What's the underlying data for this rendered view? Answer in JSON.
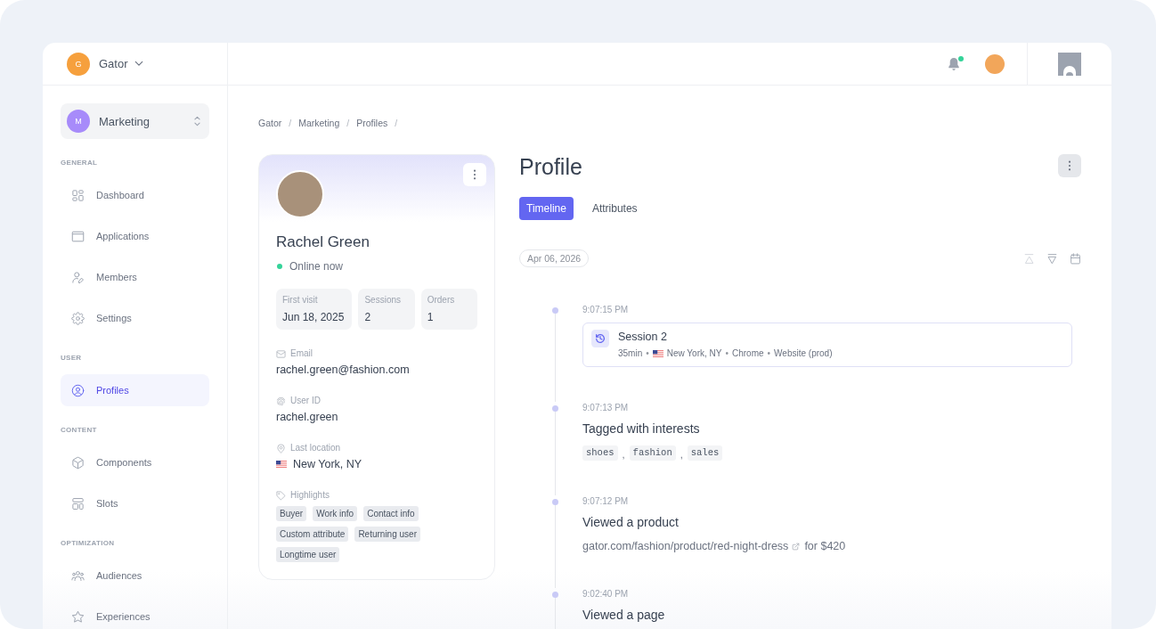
{
  "org": {
    "initial": "G",
    "name": "Gator"
  },
  "workspace": {
    "initial": "M",
    "name": "Marketing"
  },
  "sidebar": {
    "sections": [
      {
        "label": "GENERAL",
        "items": [
          {
            "label": "Dashboard",
            "selected": false
          },
          {
            "label": "Applications",
            "selected": false
          },
          {
            "label": "Members",
            "selected": false
          },
          {
            "label": "Settings",
            "selected": false
          }
        ]
      },
      {
        "label": "USER",
        "items": [
          {
            "label": "Profiles",
            "selected": true
          }
        ]
      },
      {
        "label": "CONTENT",
        "items": [
          {
            "label": "Components",
            "selected": false
          },
          {
            "label": "Slots",
            "selected": false
          }
        ]
      },
      {
        "label": "OPTIMIZATION",
        "items": [
          {
            "label": "Audiences",
            "selected": false
          },
          {
            "label": "Experiences",
            "selected": false
          }
        ]
      }
    ]
  },
  "top_bar": {
    "notifications": {
      "unread": true
    }
  },
  "breadcrumb": {
    "separator": "/",
    "items": [
      "Gator",
      "Marketing",
      "Profiles"
    ]
  },
  "profile_card": {
    "name": "Rachel Green",
    "status": {
      "label": "Online now",
      "online": true
    },
    "stats": [
      {
        "label": "First visit",
        "value": "Jun 18, 2025"
      },
      {
        "label": "Sessions",
        "value": "2"
      },
      {
        "label": "Orders",
        "value": "1"
      }
    ],
    "fields": [
      {
        "kind": "email",
        "label": "Email",
        "value": "rachel.green@fashion.com"
      },
      {
        "kind": "user_id",
        "label": "User ID",
        "value": "rachel.green"
      },
      {
        "kind": "location",
        "label": "Last location",
        "value": "New York, NY"
      },
      {
        "kind": "tags",
        "label": "Highlights",
        "tags": [
          "Buyer",
          "Work info",
          "Contact info",
          "Custom attribute",
          "Returning user",
          "Longtime user"
        ]
      }
    ]
  },
  "main": {
    "title": "Profile",
    "tabs": [
      {
        "label": "Timeline",
        "selected": true
      },
      {
        "label": "Attributes",
        "selected": false
      }
    ],
    "date": "Apr 06, 2026",
    "tools": [
      {
        "disabled": true
      },
      {
        "disabled": false
      },
      {
        "disabled": false
      }
    ],
    "timeline": [
      {
        "kind": "session",
        "time": "9:07:15 PM",
        "title": "Session 2",
        "meta_separator": "•",
        "meta": [
          {
            "kind": "text",
            "text": "35min"
          },
          {
            "kind": "location",
            "text": "New York, NY"
          },
          {
            "kind": "text",
            "text": "Chrome"
          },
          {
            "kind": "text",
            "text": "Website (prod)"
          }
        ]
      },
      {
        "kind": "tags",
        "time": "9:07:13 PM",
        "title": "Tagged with interests",
        "separator": ",",
        "tags": [
          "shoes",
          "fashion",
          "sales"
        ]
      },
      {
        "kind": "link",
        "time": "9:07:12 PM",
        "title": "Viewed a product",
        "url": "gator.com/fashion/product/red-night-dress",
        "suffix": "for $420"
      },
      {
        "kind": "title",
        "time": "9:02:40 PM",
        "title": "Viewed a page"
      }
    ]
  }
}
